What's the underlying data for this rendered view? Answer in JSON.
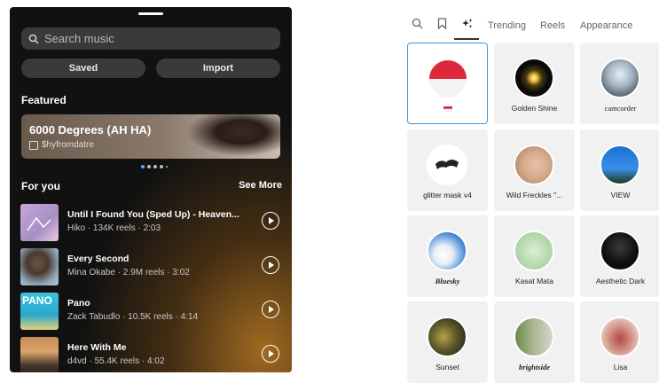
{
  "music": {
    "search_placeholder": "Search music",
    "saved_label": "Saved",
    "import_label": "Import",
    "featured_heading": "Featured",
    "featured": {
      "title": "6000 Degrees (AH HA)",
      "artist": "$hyfromdatre"
    },
    "for_you_heading": "For you",
    "see_more": "See More",
    "tracks": [
      {
        "title": "Until I Found You (Sped Up) - Heaven...",
        "meta": "Hiko · 134K reels · 2:03"
      },
      {
        "title": "Every Second",
        "meta": "Mina Okabe · 2.9M reels · 3:02"
      },
      {
        "title": "Pano",
        "meta": "Zack Tabudlo · 10.5K reels · 4:14",
        "art_text": "PANO"
      },
      {
        "title": "Here With Me",
        "meta": "d4vd · 55.4K reels · 4:02"
      }
    ]
  },
  "effects": {
    "tabs": [
      "Trending",
      "Reels",
      "Appearance"
    ],
    "items": [
      {
        "label": ""
      },
      {
        "label": "Golden Shine"
      },
      {
        "label": "camcorder"
      },
      {
        "label": "glitter mask v4"
      },
      {
        "label": "Wild Freckles \"..."
      },
      {
        "label": "VIEW"
      },
      {
        "label": "Bluesky"
      },
      {
        "label": "Kasat Mata"
      },
      {
        "label": "Aesthetic Dark"
      },
      {
        "label": "Sunset"
      },
      {
        "label": "brightside"
      },
      {
        "label": "Lisa"
      }
    ]
  },
  "colors": {
    "selection_border": "#3b9ae1",
    "dark_bg": "#111111",
    "dot_active": "#5aa9ff"
  }
}
